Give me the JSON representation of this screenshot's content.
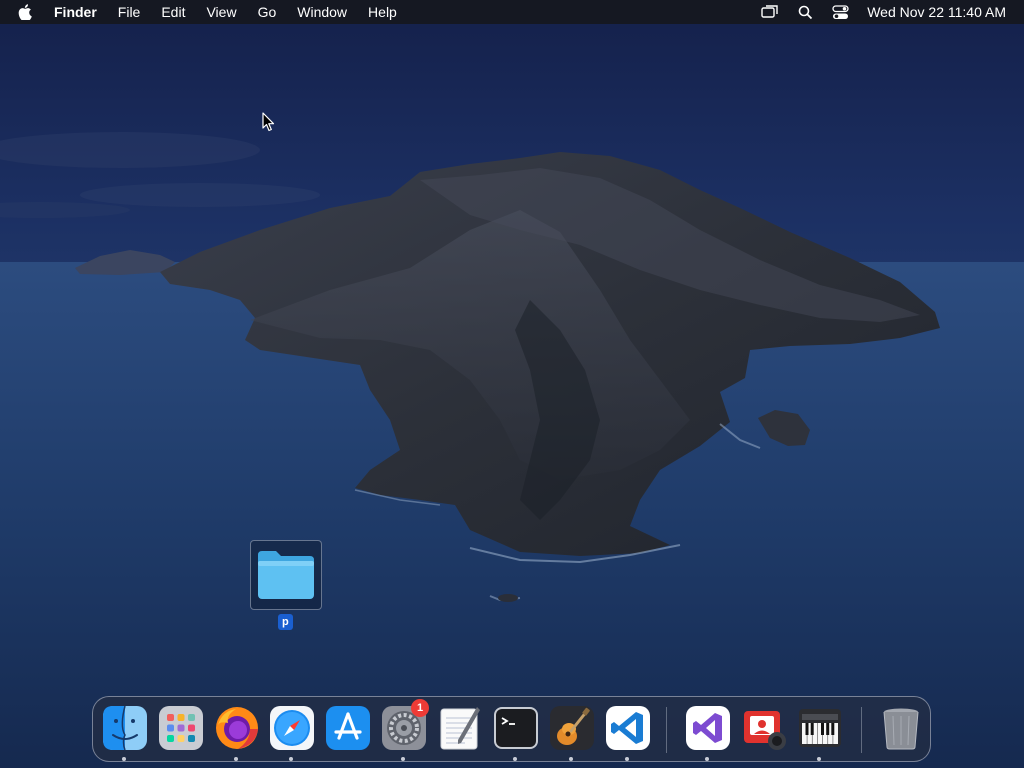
{
  "menubar": {
    "app_name": "Finder",
    "menus": [
      "File",
      "Edit",
      "View",
      "Go",
      "Window",
      "Help"
    ],
    "clock": "Wed Nov 22  11:40 AM",
    "status_icons": [
      "screen-mirroring-icon",
      "spotlight-search-icon",
      "control-center-icon"
    ]
  },
  "desktop": {
    "folder_label": "p"
  },
  "dock": {
    "apps": [
      {
        "name": "finder",
        "running": true
      },
      {
        "name": "launchpad",
        "running": false
      },
      {
        "name": "firefox",
        "running": true
      },
      {
        "name": "safari",
        "running": true
      },
      {
        "name": "app-store",
        "running": false
      },
      {
        "name": "system-preferences",
        "running": true,
        "badge": "1"
      },
      {
        "name": "textedit",
        "running": false
      },
      {
        "name": "terminal",
        "running": true
      },
      {
        "name": "garageband",
        "running": true
      },
      {
        "name": "visual-studio-code",
        "running": true
      },
      {
        "name": "visual-studio",
        "running": true
      },
      {
        "name": "photo-booth",
        "running": false
      },
      {
        "name": "piano",
        "running": true
      },
      {
        "name": "trash",
        "running": false
      }
    ]
  },
  "colors": {
    "menubar_bg": "#16181e",
    "selection_blue": "#1a5fd0",
    "badge_red": "#ee3b36"
  }
}
